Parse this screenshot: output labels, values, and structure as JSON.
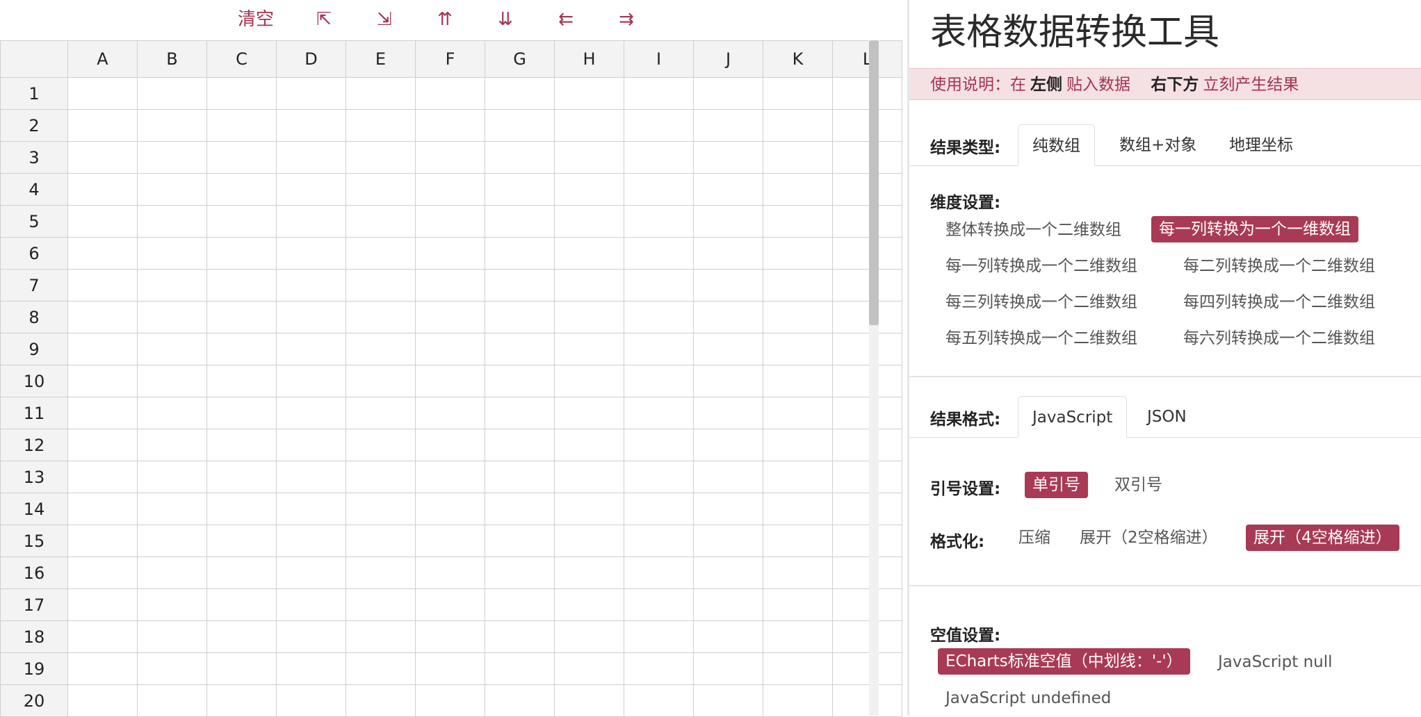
{
  "toolbar": {
    "clear_label": "清空",
    "icons": [
      {
        "glyph": "⇱",
        "name": "move-top-left-icon"
      },
      {
        "glyph": "⇲",
        "name": "move-bottom-right-icon"
      },
      {
        "glyph": "⇈",
        "name": "move-up-icon"
      },
      {
        "glyph": "⇊",
        "name": "move-down-icon"
      },
      {
        "glyph": "⇇",
        "name": "move-left-icon"
      },
      {
        "glyph": "⇉",
        "name": "move-right-icon"
      }
    ]
  },
  "grid": {
    "columns": [
      "A",
      "B",
      "C",
      "D",
      "E",
      "F",
      "G",
      "H",
      "I",
      "J",
      "K",
      "L"
    ],
    "rows": [
      "1",
      "2",
      "3",
      "4",
      "5",
      "6",
      "7",
      "8",
      "9",
      "10",
      "11",
      "12",
      "13",
      "14",
      "15",
      "16",
      "17",
      "18",
      "19",
      "20"
    ]
  },
  "right": {
    "title": "表格数据转换工具",
    "notice": {
      "prefix": "使用说明：在",
      "left_bold": "左侧",
      "middle": "贴入数据",
      "right_bold": "右下方",
      "suffix": "立刻产生结果"
    },
    "result_type": {
      "label": "结果类型:",
      "tabs": [
        "纯数组",
        "数组+对象",
        "地理坐标"
      ]
    },
    "dimension": {
      "label": "维度设置:",
      "options": [
        "整体转换成一个二维数组",
        "每一列转换为一个一维数组",
        "每一列转换成一个二维数组",
        "每二列转换成一个二维数组",
        "每三列转换成一个二维数组",
        "每四列转换成一个二维数组",
        "每五列转换成一个二维数组",
        "每六列转换成一个二维数组"
      ]
    },
    "result_format": {
      "label": "结果格式:",
      "tabs": [
        "JavaScript",
        "JSON"
      ]
    },
    "quote": {
      "label": "引号设置:",
      "options": [
        "单引号",
        "双引号"
      ]
    },
    "formatting": {
      "label": "格式化:",
      "options": [
        "压缩",
        "展开（2空格缩进）",
        "展开（4空格缩进）"
      ]
    },
    "null_value": {
      "label": "空值设置:",
      "options": [
        "ECharts标准空值（中划线：'-'）",
        "JavaScript null",
        "JavaScript undefined"
      ]
    }
  },
  "colors": {
    "accent": "#a83a55",
    "notice_bg": "#f5e1e4",
    "header_bg": "#f3f3f3",
    "grid_line": "#cfcfcf"
  }
}
